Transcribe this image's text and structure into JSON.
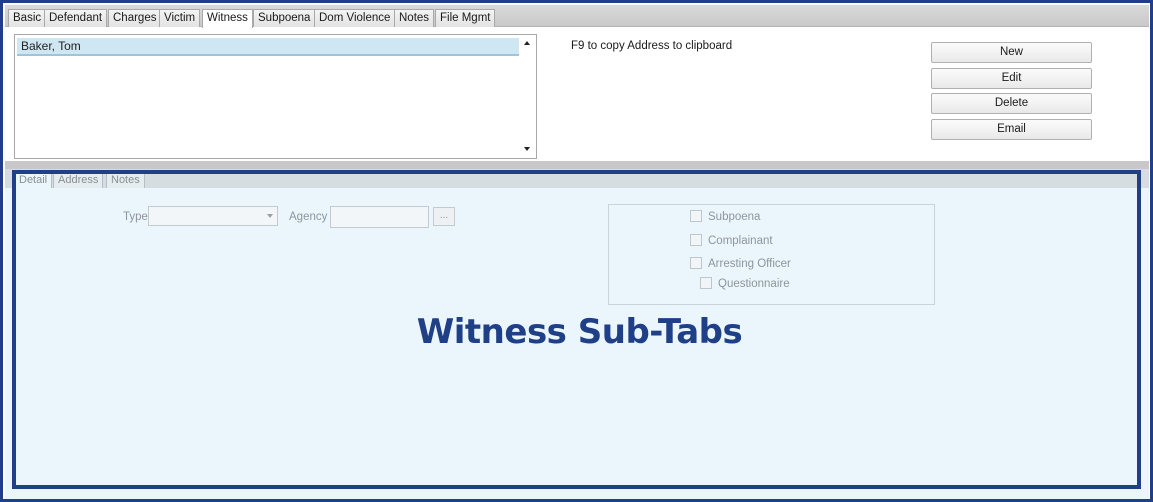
{
  "tabs": [
    {
      "label": "Basic"
    },
    {
      "label": "Defendant"
    },
    {
      "label": "Charges"
    },
    {
      "label": "Victim"
    },
    {
      "label": "Witness"
    },
    {
      "label": "Subpoena"
    },
    {
      "label": "Dom Violence"
    },
    {
      "label": "Notes"
    },
    {
      "label": "File Mgmt"
    }
  ],
  "active_tab": "Witness",
  "witness_list": {
    "items": [
      {
        "name": "Baker, Tom"
      }
    ],
    "selected": "Baker, Tom"
  },
  "hint": "F9 to copy Address to clipboard",
  "buttons": {
    "new": "New",
    "edit": "Edit",
    "delete": "Delete",
    "email": "Email"
  },
  "sub_tabs": [
    {
      "label": "Detail"
    },
    {
      "label": "Address"
    },
    {
      "label": "Notes"
    }
  ],
  "active_sub_tab": "Detail",
  "detail": {
    "type_label": "Type",
    "type_value": "",
    "agency_label": "Agency",
    "agency_value": "",
    "browse_label": "...",
    "checkboxes": {
      "subpoena": {
        "label": "Subpoena",
        "checked": false
      },
      "complainant": {
        "label": "Complainant",
        "checked": false
      },
      "arresting_officer": {
        "label": "Arresting Officer",
        "checked": false
      },
      "questionnaire": {
        "label": "Questionnaire",
        "checked": false
      }
    }
  },
  "callout": "Witness Sub-Tabs",
  "colors": {
    "accent": "#1f3f86",
    "selection": "#cfe6f3",
    "panel_bg": "#eaf6fc"
  }
}
